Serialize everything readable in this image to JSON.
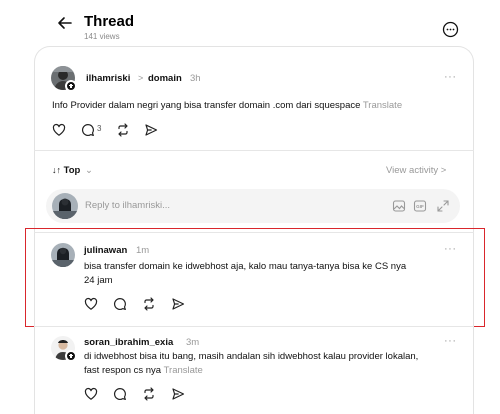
{
  "header": {
    "title": "Thread",
    "views": "141 views"
  },
  "main_post": {
    "username": "ilhamriski",
    "separator": ">",
    "community": "domain",
    "time": "3h",
    "more": "···",
    "text": "Info Provider dalam negri yang bisa transfer domain .com dari squespace",
    "translate": "Translate",
    "reply_count": "3"
  },
  "sort": {
    "label": "Top",
    "prefix": "↓↑",
    "chevron": "⌄",
    "view_activity": "View activity >"
  },
  "reply_box": {
    "placeholder": "Reply to ilhamriski..."
  },
  "replies": [
    {
      "username": "julinawan",
      "time": "1m",
      "more": "···",
      "line1": "bisa transfer domain ke idwebhost aja, kalo mau tanya-tanya bisa ke CS nya",
      "line2": "24 jam"
    },
    {
      "username": "soran_ibrahim_exia",
      "time": "3m",
      "more": "···",
      "line1": "di idwebhost bisa itu bang, masih andalan sih idwebhost kalau provider lokalan,",
      "line2": "fast respon cs nya",
      "translate": "Translate"
    }
  ],
  "colors": {
    "highlight": "#d9262c",
    "muted": "#999999",
    "text": "#111111"
  },
  "icons": [
    "back-arrow-icon",
    "more-circle-icon",
    "heart-icon",
    "comment-icon",
    "repost-icon",
    "share-icon",
    "gif-icon",
    "image-icon",
    "expand-icon",
    "plus-icon"
  ]
}
